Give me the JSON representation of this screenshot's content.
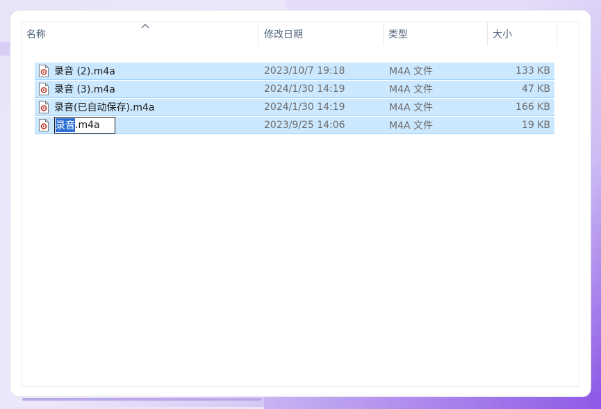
{
  "columns": {
    "name": "名称",
    "date": "修改日期",
    "type": "类型",
    "size": "大小"
  },
  "files": [
    {
      "name": "录音 (2).m4a",
      "date": "2023/10/7 19:18",
      "type": "M4A 文件",
      "size": "133 KB"
    },
    {
      "name": "录音 (3).m4a",
      "date": "2024/1/30 14:19",
      "type": "M4A 文件",
      "size": "47 KB"
    },
    {
      "name": "录音(已自动保存).m4a",
      "date": "2024/1/30 14:19",
      "type": "M4A 文件",
      "size": "166 KB"
    },
    {
      "date": "2023/9/25 14:06",
      "type": "M4A 文件",
      "size": "19 KB"
    }
  ],
  "rename": {
    "selected_text": "录音",
    "rest_text": ".m4a"
  },
  "sort": {
    "column": "name",
    "direction": "ascending"
  },
  "icon": "audio-file-icon",
  "colors": {
    "selection_bg": "#cce8ff",
    "selection_border": "#99d1ff",
    "text_selection": "#2b6fd4"
  }
}
